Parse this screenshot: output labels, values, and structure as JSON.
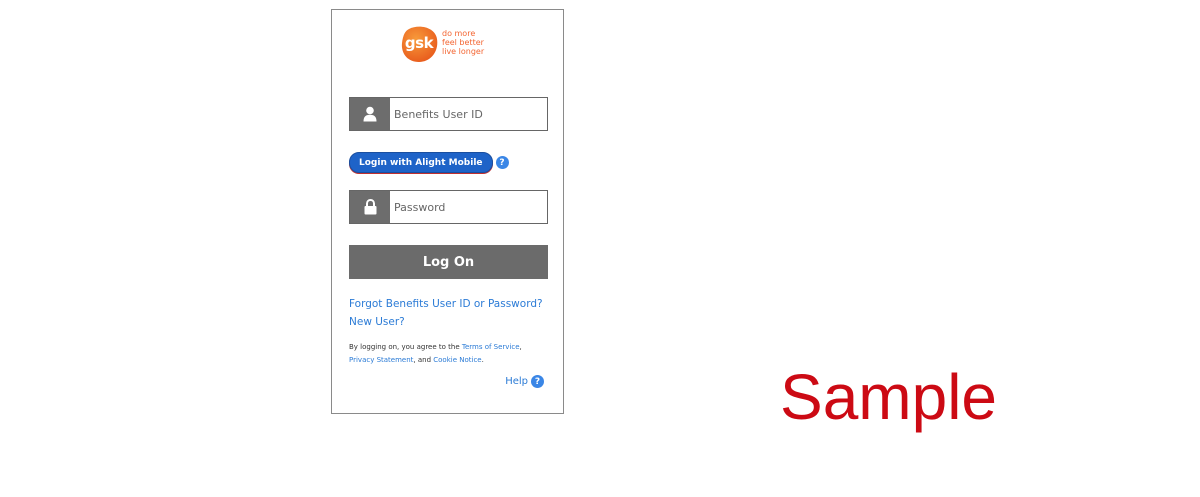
{
  "logo": {
    "brand": "gsk",
    "tagline": [
      "do more",
      "feel better",
      "live longer"
    ],
    "brand_color": "#f36633"
  },
  "login": {
    "user_icon": "user-icon",
    "user_placeholder": "Benefits User ID",
    "mobile_button": "Login with Alight Mobile",
    "help_icon": "question-circle-icon",
    "lock_icon": "lock-icon",
    "password_placeholder": "Password",
    "logon_button": "Log On",
    "forgot_link": "Forgot Benefits User ID or Password?",
    "new_user_link": "New User?",
    "terms": {
      "prefix": "By logging on, you agree to the ",
      "terms_link": "Terms of Service",
      "comma": ",",
      "privacy_link": "Privacy Statement",
      "and": ", and ",
      "cookie_link": "Cookie Notice",
      "suffix": "."
    },
    "help_label": "Help",
    "accent_color": "#1e63c8",
    "link_color": "#2b7bd6"
  },
  "watermark": "Sample"
}
